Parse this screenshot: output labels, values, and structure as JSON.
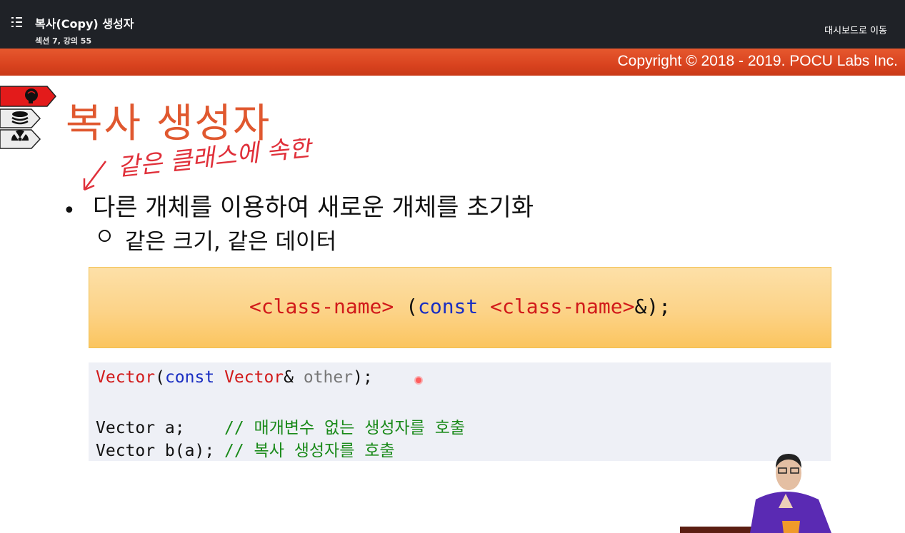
{
  "header": {
    "lecture_title": "복사(Copy) 생성자",
    "lecture_subtitle": "섹션 7, 강의 55",
    "dashboard_link": "대시보드로 이동"
  },
  "banner": {
    "copyright": "Copyright © 2018 - 2019. POCU Labs Inc."
  },
  "side_tabs": [
    "brain-icon",
    "layers-icon",
    "radiation-icon"
  ],
  "slide": {
    "title": "복사 생성자",
    "annotation": "같은 클래스에 속한",
    "bullet": "다른 개체를 이용하여 새로운 개체를 초기화",
    "sub_bullet": "같은 크기, 같은 데이터",
    "syntax": {
      "part1": "<class-name>",
      "part2": " (",
      "part3": "const",
      "part4": " ",
      "part5": "<class-name>",
      "part6": "&);"
    },
    "code": {
      "line1": {
        "a": "Vector",
        "b": "(",
        "c": "const",
        "d": " ",
        "e": "Vector",
        "f": "& ",
        "g": "other",
        "h": ");"
      },
      "line3": {
        "a": "Vector a;    ",
        "b": "// 매개변수 없는 생성자를 호출"
      },
      "line4": {
        "a": "Vector b(a); ",
        "b": "// 복사 생성자를 호출"
      }
    }
  },
  "colors": {
    "title": "#e0582f",
    "banner": "#d9431f",
    "syntax_box": "#fcd388",
    "code_box": "#eef0f6"
  }
}
